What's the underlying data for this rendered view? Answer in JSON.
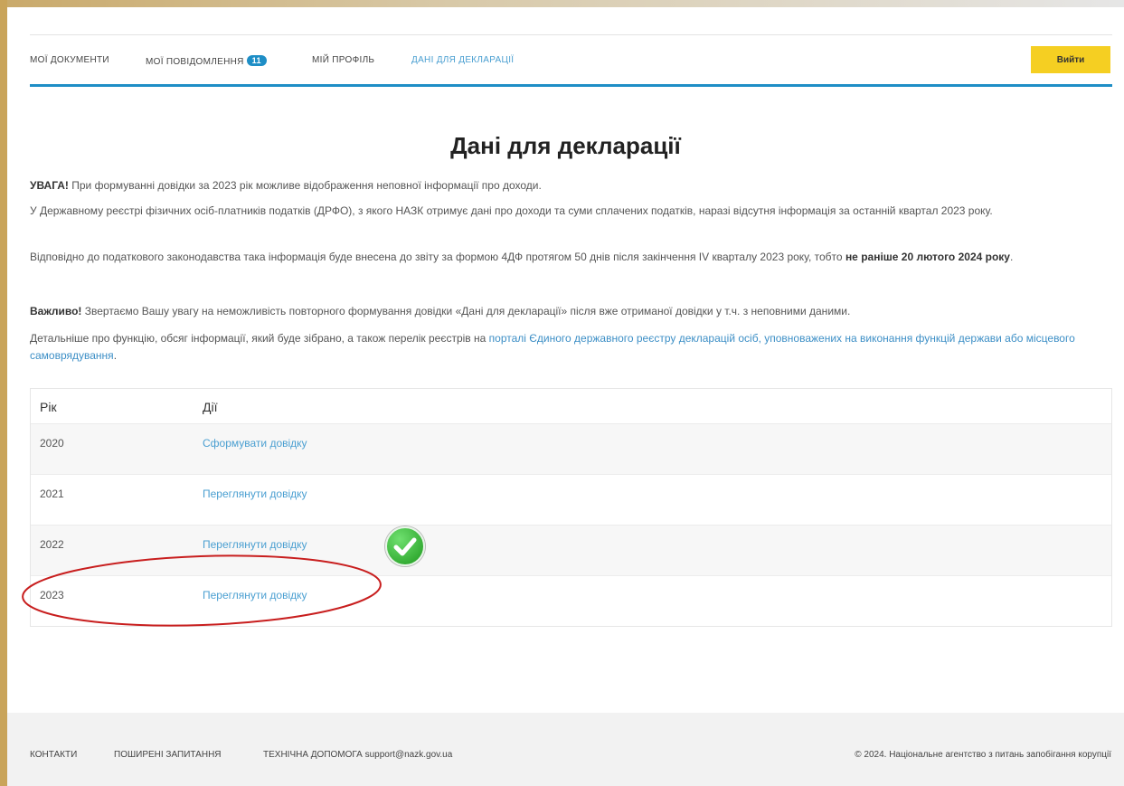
{
  "nav": {
    "items": [
      {
        "label": "МОЇ ДОКУМЕНТИ"
      },
      {
        "label": "МОЇ ПОВІДОМЛЕННЯ"
      },
      {
        "label": "МІЙ ПРОФІЛЬ"
      },
      {
        "label": "ДАНІ ДЛЯ ДЕКЛАРАЦІЇ"
      }
    ],
    "messages_badge": "11",
    "login_label": "Вийти"
  },
  "page_title": "Дані для декларації",
  "notice": {
    "p1_bold": "УВАГА!",
    "p1_text": " При формуванні довідки за 2023 рік можливе відображення неповної інформації про доходи.",
    "p2": "У Державному реєстрі фізичних осіб-платників податків (ДРФО), з якого НАЗК отримує дані про доходи та суми сплачених податків, наразі відсутня інформація за останній квартал 2023 року.",
    "p3_text": "Відповідно до податкового законодавства така інформація буде внесена до звіту за формою 4ДФ протягом 50 днів після закінчення IV кварталу 2023 року, тобто ",
    "p3_bold": "не раніше 20 лютого 2024 року",
    "p3_end": ".",
    "p4_bold": "Важливо!",
    "p4_text": " Звертаємо Вашу увагу на неможливість повторного формування довідки «Дані для декларації» після вже отриманої довідки у т.ч. з неповними даними.",
    "p5_text": "Детальніше про функцію, обсяг інформації, який буде зібрано, а також перелік реєстрів на ",
    "p5_link": "порталі Єдиного державного реєстру декларацій осіб, уповноважених на виконання функцій держави або місцевого самоврядування",
    "p5_end": "."
  },
  "table": {
    "headers": {
      "year": "Рік",
      "actions": "Дії"
    },
    "rows": [
      {
        "year": "2020",
        "action": "Сформувати довідку"
      },
      {
        "year": "2021",
        "action": "Переглянути довідку"
      },
      {
        "year": "2022",
        "action": "Переглянути довідку"
      },
      {
        "year": "2023",
        "action": "Переглянути довідку"
      }
    ]
  },
  "footer": {
    "contacts": "КОНТАКТИ",
    "faq": "ПОШИРЕНІ ЗАПИТАННЯ",
    "support_label": "ТЕХНІЧНА ДОПОМОГА",
    "support_email": "support@nazk.gov.ua",
    "copyright": "© 2024. Національне агентство з питань запобігання корупції"
  },
  "colors": {
    "accent": "#1e8ec6",
    "link": "#4a9fd1",
    "login_button": "#f5cf22",
    "highlight_ellipse": "#c81e1e",
    "check_badge": "#2aa52a"
  },
  "icons": {
    "check": "check-mark-icon",
    "highlight": "hand-drawn-ellipse"
  }
}
